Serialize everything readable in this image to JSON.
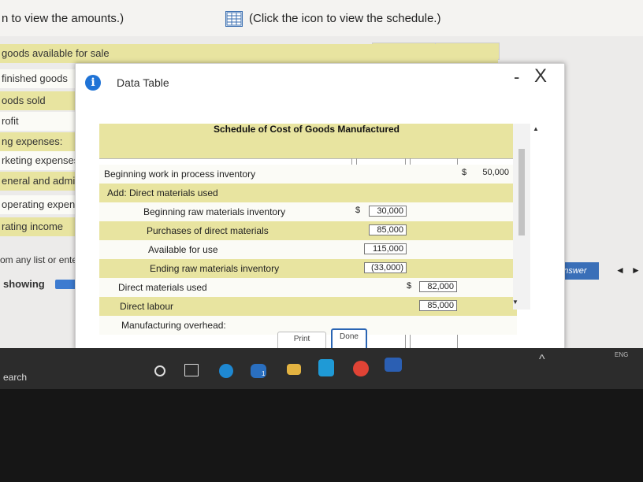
{
  "top": {
    "left_text": "n to view the amounts.)",
    "right_text": "(Click the icon to view the schedule.)"
  },
  "background_rows": [
    "goods available for sale",
    "finished goods",
    "oods sold",
    "rofit",
    "ng expenses:",
    "rketing expenses",
    "eneral and administ",
    "operating expenses",
    "rating income"
  ],
  "list_text": "om any list or enter a",
  "showing_text": "showing",
  "check_answer_label": "heck Answer",
  "nav": {
    "prev": "◄",
    "next": "►"
  },
  "dialog": {
    "title": "Data Table",
    "minimize": "-",
    "close": "X",
    "schedule_title": "Schedule of Cost of Goods Manufactured",
    "rows": {
      "wip": {
        "label": "Beginning work in process inventory",
        "dollar": "$",
        "value": "50,000"
      },
      "add_dm": {
        "label": "Add: Direct materials used"
      },
      "beg_raw": {
        "label": "Beginning raw materials inventory",
        "dollar": "$",
        "value": "30,000"
      },
      "purchases": {
        "label": "Purchases of direct materials",
        "value": "85,000"
      },
      "available": {
        "label": "Available for use",
        "value": "115,000"
      },
      "ending_raw": {
        "label": "Ending raw materials inventory",
        "value": "(33,000)"
      },
      "dm_used": {
        "label": "Direct materials used",
        "dollar": "$",
        "value": "82,000"
      },
      "labour": {
        "label": "Direct labour",
        "value": "85,000"
      },
      "overhead": {
        "label": "Manufacturing overhead:"
      }
    },
    "print_label": "Print",
    "done_label": "Done"
  },
  "taskbar": {
    "search": "earch",
    "badge": "1",
    "lang": "ENG"
  },
  "colors": {
    "yellow_row": "#e8e4a0",
    "accent_blue": "#3a6fb8"
  }
}
